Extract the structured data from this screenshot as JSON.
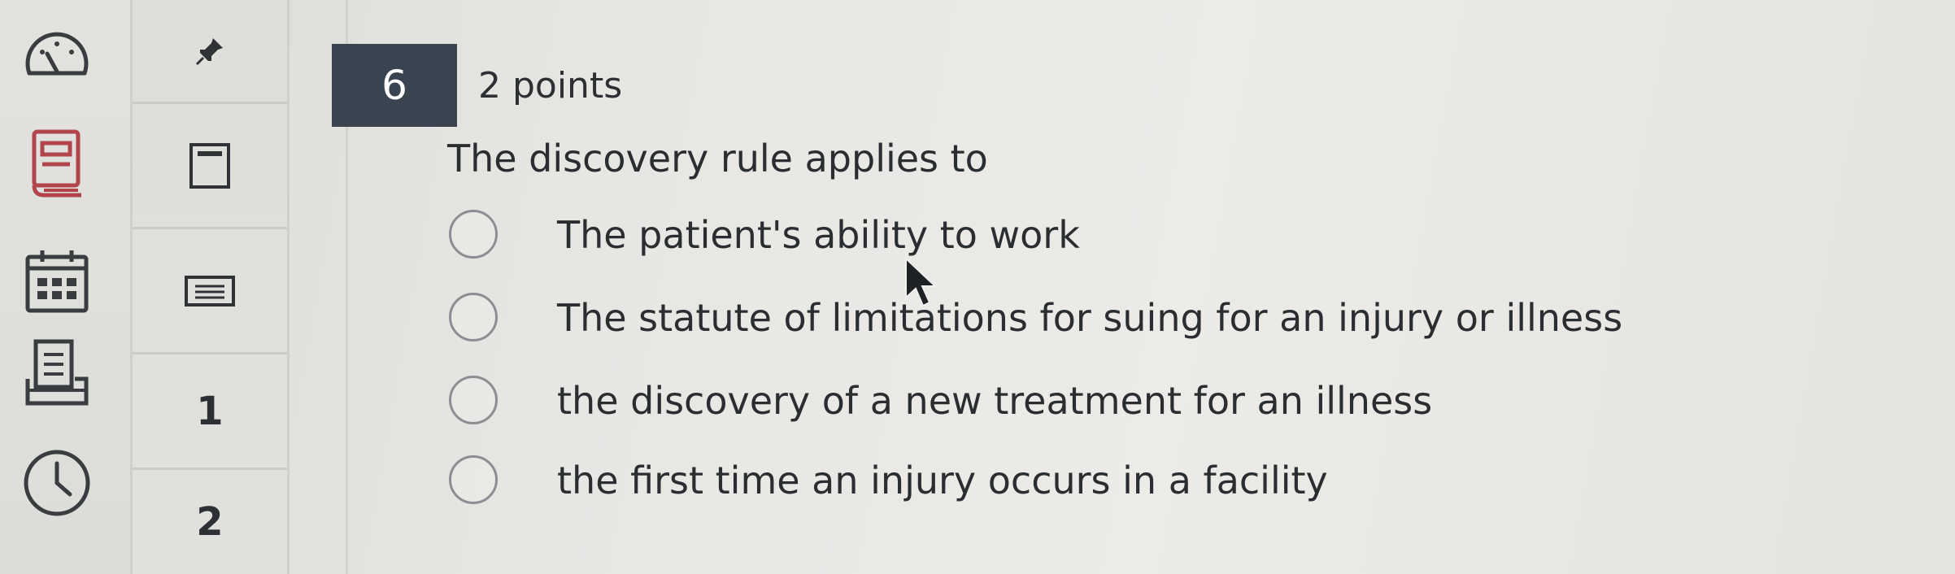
{
  "global_nav": {
    "items": [
      {
        "name": "dashboard-icon"
      },
      {
        "name": "courses-icon"
      },
      {
        "name": "calendar-icon"
      },
      {
        "name": "inbox-icon"
      },
      {
        "name": "history-icon"
      }
    ]
  },
  "question_nav": {
    "items": [
      {
        "type": "icon",
        "name": "pin-icon"
      },
      {
        "type": "icon",
        "name": "bookmark-icon"
      },
      {
        "type": "icon",
        "name": "text-entry-icon"
      },
      {
        "type": "number",
        "label": "1"
      },
      {
        "type": "number",
        "label": "2"
      }
    ]
  },
  "question": {
    "number": "6",
    "points": "2 points",
    "text": "The discovery rule applies to",
    "options": [
      {
        "label": "The patient's ability to work"
      },
      {
        "label": "The statute of limitations for suing for an injury or illness"
      },
      {
        "label": "the discovery of a new treatment for an illness"
      },
      {
        "label": "the first time an injury occurs in a facility"
      }
    ]
  },
  "colors": {
    "question_box": "#3a4450",
    "courses_icon": "#b2454c",
    "text": "#2b2e31"
  }
}
